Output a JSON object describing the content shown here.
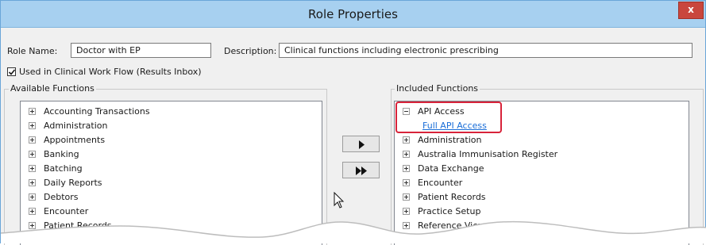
{
  "window": {
    "title": "Role Properties",
    "close_label": "x"
  },
  "role": {
    "name_label": "Role Name:",
    "name_value": "Doctor with EP",
    "description_label": "Description:",
    "description_value": "Clinical functions including electronic prescribing",
    "workflow_checkbox_label": "Used in Clinical Work Flow (Results Inbox)",
    "workflow_checked": true
  },
  "available": {
    "title": "Available Functions",
    "items": [
      "Accounting Transactions",
      "Administration",
      "Appointments",
      "Banking",
      "Batching",
      "Daily Reports",
      "Debtors",
      "Encounter",
      "Patient Records"
    ]
  },
  "included": {
    "title": "Included Functions",
    "items": [
      {
        "label": "API Access",
        "expanded": true,
        "children": [
          "Full API Access"
        ]
      },
      {
        "label": "Administration",
        "expanded": false
      },
      {
        "label": "Australia Immunisation Register",
        "expanded": false
      },
      {
        "label": "Data Exchange",
        "expanded": false
      },
      {
        "label": "Encounter",
        "expanded": false
      },
      {
        "label": "Patient Records",
        "expanded": false
      },
      {
        "label": "Practice Setup",
        "expanded": false
      },
      {
        "label": "Reference View",
        "expanded": false
      }
    ]
  },
  "buttons": {
    "add_one_icon": "play-icon",
    "add_all_icon": "fast-forward-icon"
  },
  "colors": {
    "title_bar": "#a7d0f0",
    "highlight": "#d8233a",
    "link": "#1a6ed8",
    "close": "#c9463d"
  }
}
